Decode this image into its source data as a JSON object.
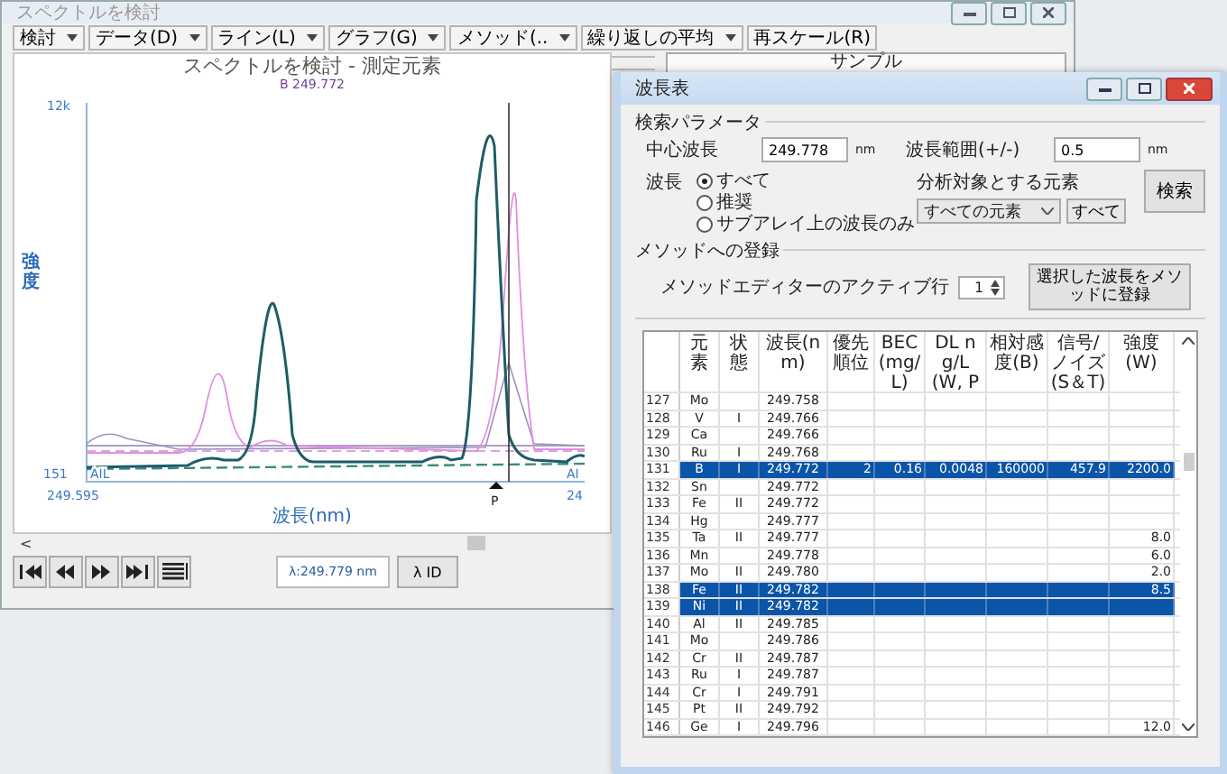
{
  "back_window": {
    "title": "スペクトルを検討"
  },
  "toolbar": [
    {
      "label": "検討",
      "dropdown": true
    },
    {
      "label": "データ(D)",
      "dropdown": true
    },
    {
      "label": "ライン(L)",
      "dropdown": true
    },
    {
      "label": "グラフ(G)",
      "dropdown": true
    },
    {
      "label": "メソッド(..",
      "dropdown": true
    },
    {
      "label": "繰り返しの平均",
      "dropdown": true
    },
    {
      "label": "再スケール(R)",
      "dropdown": false
    }
  ],
  "chart": {
    "title": "スペクトルを検討 - 測定元素",
    "marker_label": "B 249.772",
    "y_max": "12k",
    "y_min": "151",
    "y_axis_title": "強度",
    "x_axis_title": "波長(nm)",
    "x_start": "249.595",
    "x_end": "24",
    "left_line_label": "AIL",
    "right_line_label": "AI",
    "peak_marker": "P"
  },
  "scroll_arrow": "<",
  "nav_buttons": [
    {
      "kind": "first"
    },
    {
      "kind": "prev"
    },
    {
      "kind": "next"
    },
    {
      "kind": "last"
    },
    {
      "kind": "list"
    }
  ],
  "wavelength_readout": "λ:249.779 nm",
  "id_button": "λ ID",
  "sample_panel": {
    "title": "サンプル"
  },
  "dialog": {
    "title": "波長表",
    "search_group": "検索パラメータ",
    "center_label": "中心波長",
    "center_value": "249.778",
    "center_unit": "nm",
    "range_label": "波長範囲(+/-)",
    "range_value": "0.5",
    "range_unit": "nm",
    "wavelength_label": "波長",
    "radios": [
      {
        "label": "すべて",
        "selected": true
      },
      {
        "label": "推奨",
        "selected": false
      },
      {
        "label": "サブアレイ上の波長のみ",
        "selected": false
      }
    ],
    "element_label": "分析対象とする元素",
    "element_select": "すべての元素",
    "all_button": "すべて",
    "search_button": "検索",
    "method_group": "メソッドへの登録",
    "active_row_label": "メソッドエディターのアクティブ行",
    "active_row_value": "1",
    "register_button": "選択した波長をメソッドに登録"
  },
  "table": {
    "columns": [
      "元素",
      "状態",
      "波長(nm)",
      "優先順位",
      "BEC(mg/L)",
      "DL ng/L(W, P",
      "相対感度(B)",
      "信号/ノイズ(S＆T)",
      "強度(W)"
    ],
    "rows": [
      {
        "number": "127",
        "element": "Mo",
        "wavelength": "249.758",
        "selected": false
      },
      {
        "number": "128",
        "element": "V",
        "state": "I",
        "wavelength": "249.766",
        "selected": false
      },
      {
        "number": "129",
        "element": "Ca",
        "wavelength": "249.766",
        "selected": false
      },
      {
        "number": "130",
        "element": "Ru",
        "state": "I",
        "wavelength": "249.768",
        "selected": false
      },
      {
        "number": "131",
        "element": "B",
        "state": "I",
        "wavelength": "249.772",
        "priority": "2",
        "bec": "0.16",
        "dl": "0.0048",
        "sensitivity": "160000",
        "snr": "457.9",
        "intensity": "2200.0",
        "selected": true
      },
      {
        "number": "132",
        "element": "Sn",
        "wavelength": "249.772",
        "selected": false
      },
      {
        "number": "133",
        "element": "Fe",
        "state": "II",
        "wavelength": "249.772",
        "selected": false
      },
      {
        "number": "134",
        "element": "Hg",
        "wavelength": "249.777",
        "selected": false
      },
      {
        "number": "135",
        "element": "Ta",
        "state": "II",
        "wavelength": "249.777",
        "intensity": "8.0",
        "selected": false
      },
      {
        "number": "136",
        "element": "Mn",
        "wavelength": "249.778",
        "intensity": "6.0",
        "selected": false
      },
      {
        "number": "137",
        "element": "Mo",
        "state": "II",
        "wavelength": "249.780",
        "intensity": "2.0",
        "selected": false
      },
      {
        "number": "138",
        "element": "Fe",
        "state": "II",
        "wavelength": "249.782",
        "intensity": "8.5",
        "selected": true
      },
      {
        "number": "139",
        "element": "Ni",
        "state": "II",
        "wavelength": "249.782",
        "selected": true
      },
      {
        "number": "140",
        "element": "Al",
        "state": "II",
        "wavelength": "249.785",
        "selected": false
      },
      {
        "number": "141",
        "element": "Mo",
        "wavelength": "249.786",
        "selected": false
      },
      {
        "number": "142",
        "element": "Cr",
        "state": "II",
        "wavelength": "249.787",
        "selected": false
      },
      {
        "number": "143",
        "element": "Ru",
        "state": "I",
        "wavelength": "249.787",
        "selected": false
      },
      {
        "number": "144",
        "element": "Cr",
        "state": "I",
        "wavelength": "249.791",
        "selected": false
      },
      {
        "number": "145",
        "element": "Pt",
        "state": "II",
        "wavelength": "249.792",
        "selected": false
      },
      {
        "number": "146",
        "element": "Ge",
        "state": "I",
        "wavelength": "249.796",
        "intensity": "12.0",
        "selected": false
      }
    ]
  }
}
